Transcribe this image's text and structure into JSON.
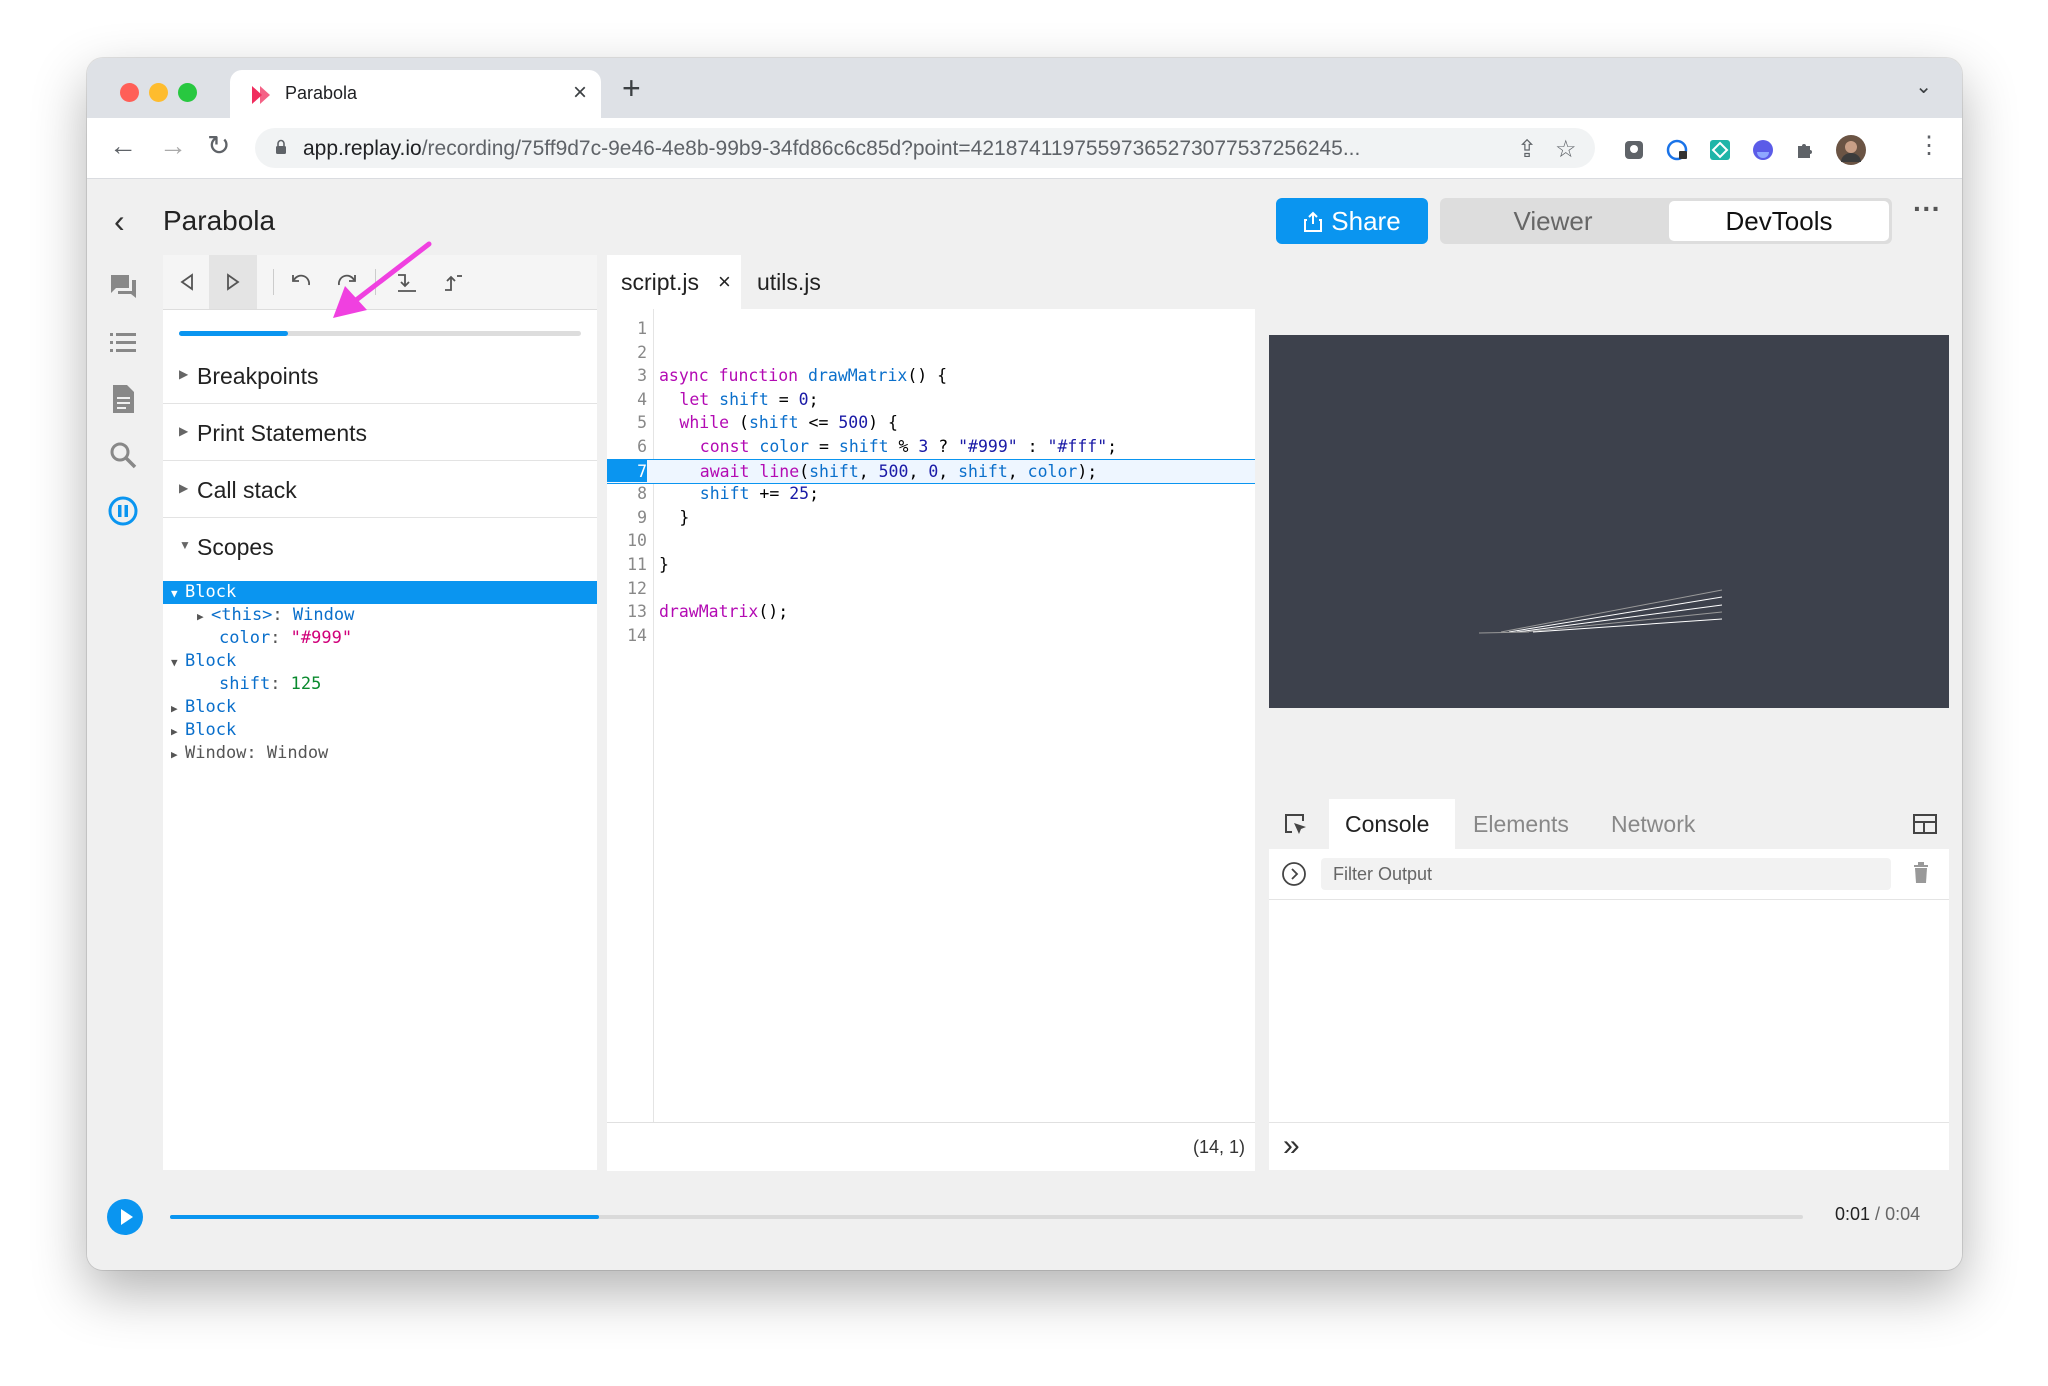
{
  "browser": {
    "tab_title": "Parabola",
    "url_host": "app.replay.io",
    "url_path": "/recording/75ff9d7c-9e46-4e8b-99b9-34fd86c6c85d?point=42187411975597365273077537256245..."
  },
  "app": {
    "title": "Parabola",
    "share_label": "Share",
    "mode_viewer": "Viewer",
    "mode_devtools": "DevTools",
    "active_mode": "DevTools"
  },
  "debugger": {
    "progress_fraction": 0.27,
    "sections": [
      {
        "label": "Breakpoints",
        "expanded": false
      },
      {
        "label": "Print Statements",
        "expanded": false
      },
      {
        "label": "Call stack",
        "expanded": false
      },
      {
        "label": "Scopes",
        "expanded": true
      }
    ],
    "scopes": {
      "block1": "Block",
      "this_key": "<this>",
      "this_sep": ": ",
      "this_value": "Window",
      "color_key": "color",
      "color_sep": ": ",
      "color_value": "\"#999\"",
      "block2": "Block",
      "shift_key": "shift",
      "shift_sep": ": ",
      "shift_value": "125",
      "block3": "Block",
      "block4": "Block",
      "window_row": "Window: Window"
    }
  },
  "editor": {
    "tabs": [
      {
        "label": "script.js",
        "active": true,
        "closable": true
      },
      {
        "label": "utils.js",
        "active": false
      }
    ],
    "close_glyph": "×",
    "lines": [
      {
        "n": "1"
      },
      {
        "n": "2"
      },
      {
        "n": "3",
        "t": [
          "async",
          "function",
          "drawMatrix",
          "() {"
        ]
      },
      {
        "n": "4",
        "t": [
          "let",
          "shift",
          " = ",
          "0",
          ";"
        ]
      },
      {
        "n": "5",
        "t": [
          "while",
          " (",
          "shift",
          " <= ",
          "500",
          ") {"
        ]
      },
      {
        "n": "6",
        "t": [
          "const",
          "color",
          " = ",
          "shift",
          " % ",
          "3",
          " ? ",
          "\"#999\"",
          " : ",
          "\"#fff\"",
          ";"
        ]
      },
      {
        "n": "7",
        "t": [
          "await",
          "line",
          "(",
          "shift",
          ", ",
          "500",
          ", ",
          "0",
          ", ",
          "shift",
          ", ",
          "color",
          ");"
        ]
      },
      {
        "n": "8",
        "t": [
          "shift",
          " += ",
          "25",
          ";"
        ]
      },
      {
        "n": "9",
        "t": [
          "}"
        ]
      },
      {
        "n": "10"
      },
      {
        "n": "11",
        "t": [
          "}"
        ]
      },
      {
        "n": "12"
      },
      {
        "n": "13",
        "t": [
          "drawMatrix",
          "();"
        ]
      },
      {
        "n": "14"
      }
    ],
    "current_line": "7",
    "cursor_position": "(14, 1)"
  },
  "console": {
    "tabs": [
      {
        "label": "Console",
        "active": true
      },
      {
        "label": "Elements",
        "active": false
      },
      {
        "label": "Network",
        "active": false
      }
    ],
    "filter_placeholder": "Filter Output",
    "prompt_glyph": "»"
  },
  "timeline": {
    "progress_fraction": 0.263,
    "current_time": "0:01",
    "separator": " / ",
    "total_time": "0:04"
  },
  "colors": {
    "accent": "#0a95f0",
    "annotation": "#f040e0",
    "canvas_bg": "#3d414c"
  }
}
